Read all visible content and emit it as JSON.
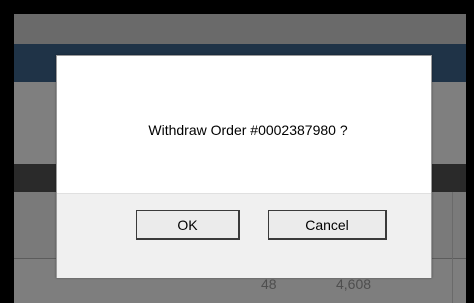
{
  "background": {
    "values": [
      "48",
      "4,608"
    ]
  },
  "dialog": {
    "message": "Withdraw Order #0002387980 ?",
    "ok_label": "OK",
    "cancel_label": "Cancel"
  },
  "colors": {
    "overlay": "#7d7d7d",
    "header_bar": "#1f3347",
    "dialog_background": "#ffffff",
    "dialog_footer": "#f0f0f0",
    "button_face": "#ebebeb"
  }
}
